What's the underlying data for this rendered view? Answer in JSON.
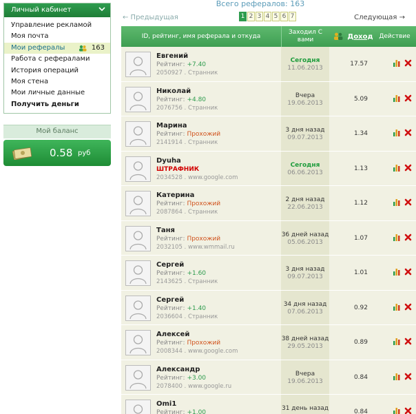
{
  "sidebar": {
    "title": "Личный кабинет",
    "items": [
      {
        "label": "Управление рекламой"
      },
      {
        "label": "Моя почта"
      },
      {
        "label": "Мои рефералы",
        "count": "163",
        "active": true
      },
      {
        "label": "Работа с рефералами"
      },
      {
        "label": "История операций"
      },
      {
        "label": "Моя стена"
      },
      {
        "label": "Мои личные данные"
      },
      {
        "label": "Получить деньги",
        "bold": true
      }
    ],
    "balance_title": "Мой баланс",
    "balance_amount": "0.58",
    "balance_currency": "руб"
  },
  "main": {
    "total": "Всего рефералов: 163",
    "prev": "← Предыдущая",
    "next": "Следующая →",
    "pages": [
      "1",
      "2",
      "3",
      "4",
      "5",
      "6",
      "7"
    ],
    "current_page": "1",
    "headers": {
      "id": "ID, рейтинг, имя реферала и откуда",
      "visit": "Заходил С вами",
      "income": "Доход",
      "action": "Действие"
    },
    "rows": [
      {
        "name": "Евгений",
        "rating_label": "Рейтинг:",
        "rating": "+7.40",
        "rating_warn": false,
        "penalty": "",
        "src": "2050927 . Странник",
        "when": "Сегодня",
        "today": true,
        "date": "11.06.2013",
        "income": "17.57"
      },
      {
        "name": "Николай",
        "rating_label": "Рейтинг:",
        "rating": "+4.80",
        "rating_warn": false,
        "penalty": "",
        "src": "2076756 . Странник",
        "when": "Вчера",
        "today": false,
        "date": "19.06.2013",
        "income": "5.09"
      },
      {
        "name": "Марина",
        "rating_label": "Рейтинг:",
        "rating": "Прохожий",
        "rating_warn": true,
        "penalty": "",
        "src": "2141914 . Странник",
        "when": "3 дня назад",
        "today": false,
        "date": "09.07.2013",
        "income": "1.34"
      },
      {
        "name": "Dyuha",
        "rating_label": "",
        "rating": "",
        "rating_warn": false,
        "penalty": "ШТРАФНИК",
        "src": "2034528 . www.google.com",
        "when": "Сегодня",
        "today": true,
        "date": "06.06.2013",
        "income": "1.13"
      },
      {
        "name": "Катерина",
        "rating_label": "Рейтинг:",
        "rating": "Прохожий",
        "rating_warn": true,
        "penalty": "",
        "src": "2087864 . Странник",
        "when": "2 дня назад",
        "today": false,
        "date": "22.06.2013",
        "income": "1.12"
      },
      {
        "name": "Таня",
        "rating_label": "Рейтинг:",
        "rating": "Прохожий",
        "rating_warn": true,
        "penalty": "",
        "src": "2032105 . www.wmmail.ru",
        "when": "36 дней назад",
        "today": false,
        "date": "05.06.2013",
        "income": "1.07"
      },
      {
        "name": "Сергей",
        "rating_label": "Рейтинг:",
        "rating": "+1.60",
        "rating_warn": false,
        "penalty": "",
        "src": "2143625 . Странник",
        "when": "3 дня назад",
        "today": false,
        "date": "09.07.2013",
        "income": "1.01"
      },
      {
        "name": "Сергей",
        "rating_label": "Рейтинг:",
        "rating": "+1.40",
        "rating_warn": false,
        "penalty": "",
        "src": "2036604 . Странник",
        "when": "34 дня назад",
        "today": false,
        "date": "07.06.2013",
        "income": "0.92"
      },
      {
        "name": "Алексей",
        "rating_label": "Рейтинг:",
        "rating": "Прохожий",
        "rating_warn": true,
        "penalty": "",
        "src": "2008344 . www.google.com",
        "when": "38 дней назад",
        "today": false,
        "date": "29.05.2013",
        "income": "0.89"
      },
      {
        "name": "Александр",
        "rating_label": "Рейтинг:",
        "rating": "+3.00",
        "rating_warn": false,
        "penalty": "",
        "src": "2078400 . www.google.ru",
        "when": "Вчера",
        "today": false,
        "date": "19.06.2013",
        "income": "0.84"
      },
      {
        "name": "Omi1",
        "rating_label": "Рейтинг:",
        "rating": "+1.00",
        "rating_warn": false,
        "penalty": "",
        "src": "",
        "when": "31 день назад",
        "today": false,
        "date": "",
        "income": "0.84"
      }
    ]
  },
  "colors": {
    "accent": "#2e9c4e",
    "header_green": "#4fae62",
    "warn": "#d0521c",
    "penalty": "#d20000",
    "link_blue": "#5a9bb8"
  }
}
